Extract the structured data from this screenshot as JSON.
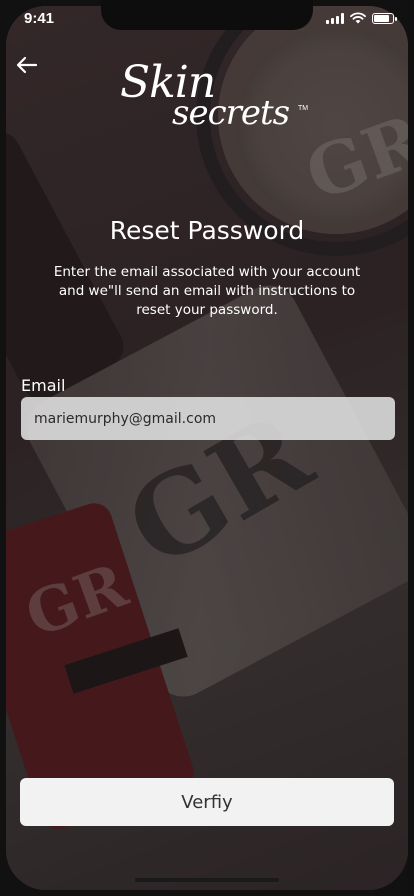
{
  "status_bar": {
    "time": "9:41"
  },
  "logo": {
    "line1": "Skin",
    "line2": "secrets",
    "tm": "TM"
  },
  "page": {
    "title": "Reset Password",
    "subtitle": "Enter the email associated with your account and we\"ll send an email with instructions to reset your password."
  },
  "form": {
    "email_label": "Email",
    "email_value": "mariemurphy@gmail.com"
  },
  "actions": {
    "verify_label": "Verfiy"
  },
  "icons": {
    "back": "arrow-left-icon",
    "signal": "cellular-signal-icon",
    "wifi": "wifi-icon",
    "battery": "battery-icon"
  }
}
